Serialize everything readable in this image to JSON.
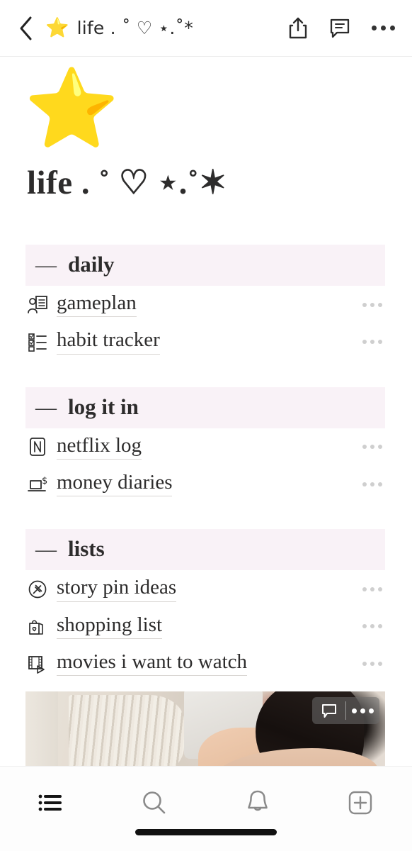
{
  "topbar": {
    "back_icon": "chevron-left-icon",
    "star_emoji": "⭐",
    "title": "life . ˚ ♡ ⋆.˚*",
    "share_icon": "share-icon",
    "comment_icon": "comment-icon",
    "more_icon": "more-horizontal-icon"
  },
  "page": {
    "icon": "⭐",
    "title": "life . ˚  ♡  ⋆.˚✶"
  },
  "sections": [
    {
      "dash": "—",
      "name": "daily",
      "items": [
        {
          "icon": "person-checklist-icon",
          "label": "gameplan",
          "more": "more-horizontal-icon"
        },
        {
          "icon": "checkbox-list-icon",
          "label": "habit tracker",
          "more": "more-horizontal-icon"
        }
      ]
    },
    {
      "dash": "—",
      "name": "log it in",
      "items": [
        {
          "icon": "netflix-icon",
          "label": "netflix log",
          "more": "more-horizontal-icon"
        },
        {
          "icon": "laptop-dollar-icon",
          "label": "money diaries",
          "more": "more-horizontal-icon"
        }
      ]
    },
    {
      "dash": "—",
      "name": "lists",
      "items": [
        {
          "icon": "pin-circle-icon",
          "label": "story pin ideas",
          "more": "more-horizontal-icon"
        },
        {
          "icon": "shopping-bag-heart-icon",
          "label": "shopping list",
          "more": "more-horizontal-icon"
        },
        {
          "icon": "film-play-icon",
          "label": "movies i want to watch",
          "more": "more-horizontal-icon"
        }
      ]
    }
  ],
  "image_block": {
    "alt": "mirror selfie with clothing hangers",
    "comment_icon": "comment-icon",
    "more_icon": "more-horizontal-icon"
  },
  "tabbar": {
    "items": [
      {
        "icon": "list-icon",
        "active": true
      },
      {
        "icon": "search-icon",
        "active": false
      },
      {
        "icon": "bell-icon",
        "active": false
      },
      {
        "icon": "plus-box-icon",
        "active": false
      }
    ]
  },
  "colors": {
    "section_header_bg": "#f9f2f7",
    "text": "#2d2c2c",
    "underline": "#d9d6d3",
    "dots_muted": "#cfcfcf",
    "tab_active": "#111111",
    "tab_inactive": "#8a8a8a"
  }
}
